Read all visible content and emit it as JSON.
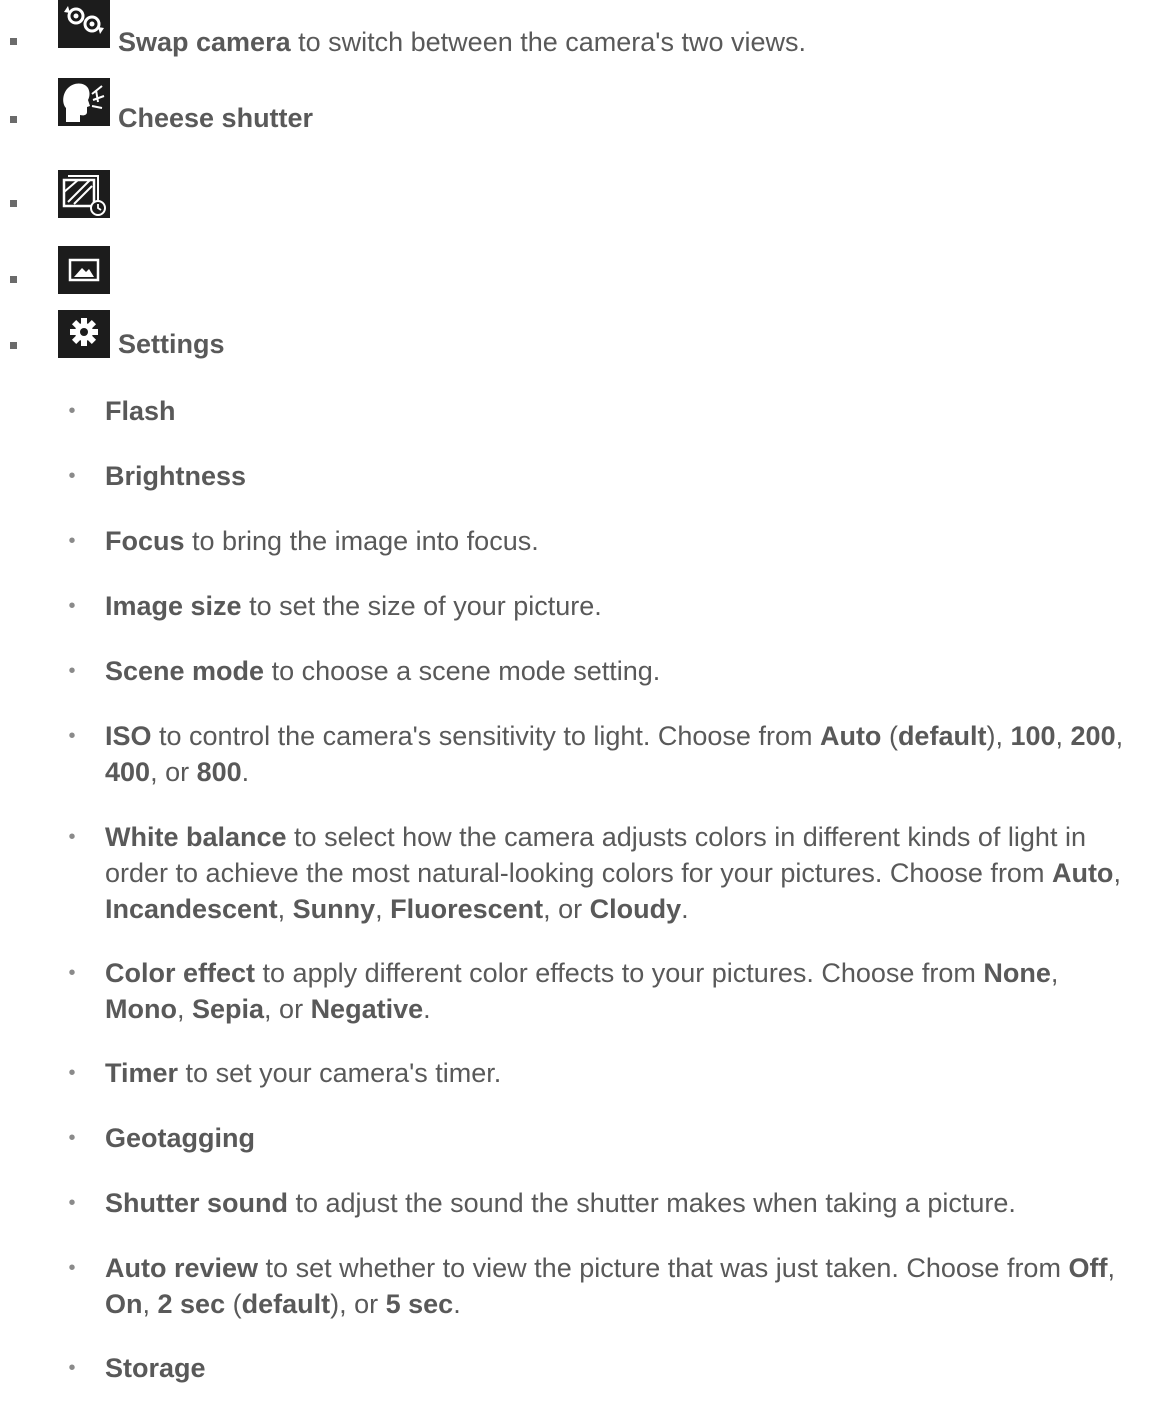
{
  "items": {
    "swap": {
      "label": "Swap camera",
      "text": " to switch between the camera's two views."
    },
    "cheese": {
      "label": "Cheese shutter"
    },
    "settings": {
      "label": "Settings"
    }
  },
  "icons": {
    "swap": "swap-camera-icon",
    "cheese": "cheese-shutter-icon",
    "burst": "burst-shot-icon",
    "gallery": "gallery-icon",
    "settings": "gear-icon"
  },
  "settings": {
    "flash": {
      "label": "Flash"
    },
    "brightness": {
      "label": "Brightness"
    },
    "focus": {
      "label": "Focus",
      "text": " to bring the image into focus."
    },
    "image_size": {
      "label": "Image size",
      "text": " to set the size of your picture."
    },
    "scene_mode": {
      "label": "Scene mode",
      "text": " to choose a scene mode setting."
    },
    "iso": {
      "label": "ISO",
      "text": " to control the camera's sensitivity to light. Choose from ",
      "opt1": "Auto",
      "paren_open": " (",
      "default": "default",
      "paren_close": "), ",
      "opt2": "100",
      "sep1": ", ",
      "opt3": "200",
      "sep2": ", ",
      "opt4": "400",
      "or": ", or ",
      "opt5": "800",
      "end": "."
    },
    "white_balance": {
      "label": "White balance",
      "text": " to select how the camera adjusts colors in different kinds of light in order to achieve the most natural-looking colors for your pictures. Choose from ",
      "opt1": "Auto",
      "sep1": ", ",
      "opt2": "Incandescent",
      "sep2": ", ",
      "opt3": "Sunny",
      "sep3": ", ",
      "opt4": "Fluorescent",
      "or": ", or ",
      "opt5": "Cloudy",
      "end": "."
    },
    "color_effect": {
      "label": "Color effect",
      "text": " to apply different color effects to your pictures. Choose from ",
      "opt1": "None",
      "sep1": ", ",
      "opt2": "Mono",
      "sep2": ", ",
      "opt3": "Sepia",
      "or": ", or ",
      "opt4": "Negative",
      "end": "."
    },
    "timer": {
      "label": "Timer",
      "text": " to set your camera's timer."
    },
    "geotagging": {
      "label": "Geotagging"
    },
    "shutter_sound": {
      "label": "Shutter sound",
      "text": " to adjust the sound the shutter makes when taking a picture."
    },
    "auto_review": {
      "label": "Auto review",
      "text": " to set whether to view the picture that was just taken. Choose from ",
      "opt1": "Off",
      "sep1": ", ",
      "opt2": "On",
      "sep2": ", ",
      "opt3": "2 sec",
      "paren_open": " (",
      "default": "default",
      "paren_close": "), or ",
      "opt4": "5 sec",
      "end": "."
    },
    "storage": {
      "label": "Storage"
    }
  },
  "bullets": {
    "square": "▪",
    "dot": "•"
  }
}
